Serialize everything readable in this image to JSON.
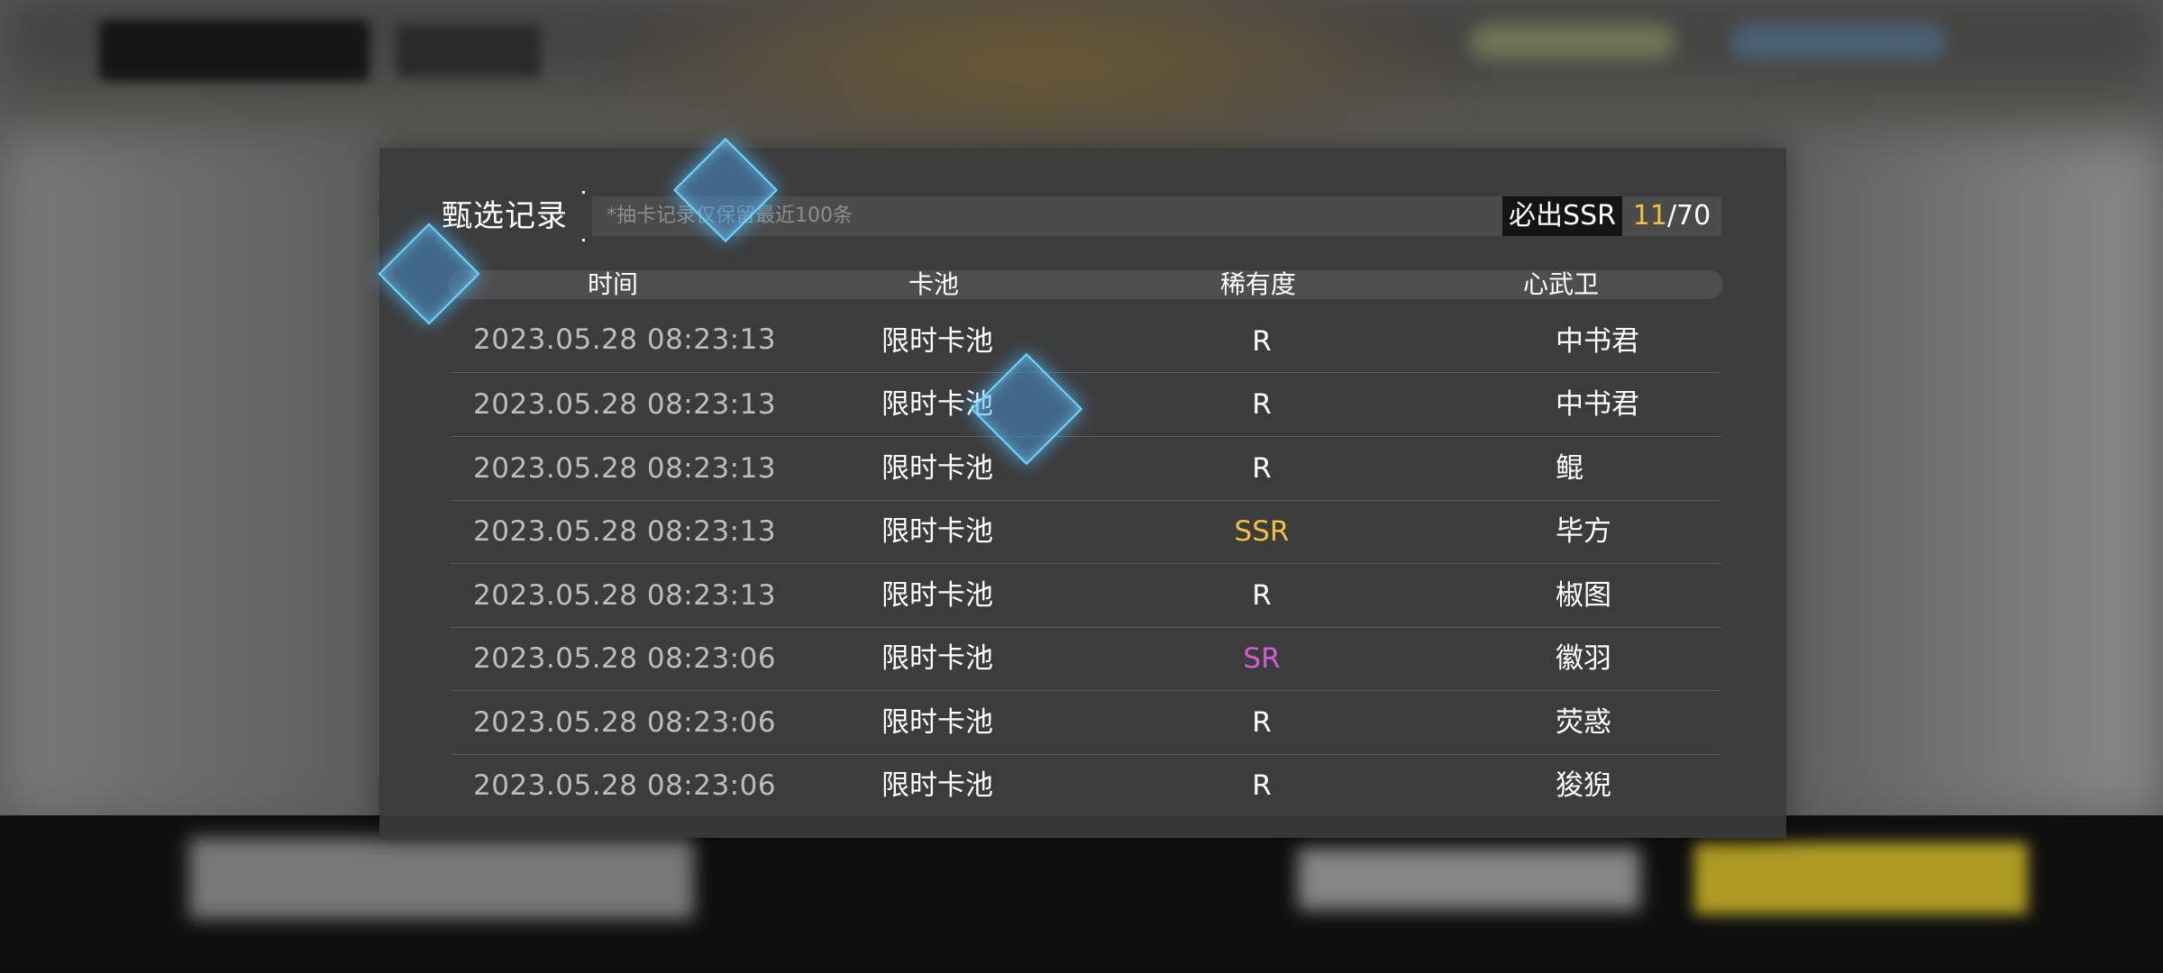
{
  "dialog": {
    "title": "甄选记录",
    "notice": "*抽卡记录仅保留最近100条",
    "guarantee": {
      "label": "必出SSR",
      "current": "11",
      "separator": "/",
      "total": "70"
    }
  },
  "table": {
    "headers": [
      "时间",
      "卡池",
      "稀有度",
      "心武卫"
    ],
    "rows": [
      {
        "time": "2023.05.28  08:23:13",
        "pool": "限时卡池",
        "rarity": "R",
        "name": "中书君"
      },
      {
        "time": "2023.05.28  08:23:13",
        "pool": "限时卡池",
        "rarity": "R",
        "name": "中书君"
      },
      {
        "time": "2023.05.28  08:23:13",
        "pool": "限时卡池",
        "rarity": "R",
        "name": "鲲"
      },
      {
        "time": "2023.05.28  08:23:13",
        "pool": "限时卡池",
        "rarity": "SSR",
        "name": "毕方"
      },
      {
        "time": "2023.05.28  08:23:13",
        "pool": "限时卡池",
        "rarity": "R",
        "name": "椒图"
      },
      {
        "time": "2023.05.28  08:23:06",
        "pool": "限时卡池",
        "rarity": "SR",
        "name": "徽羽"
      },
      {
        "time": "2023.05.28  08:23:06",
        "pool": "限时卡池",
        "rarity": "R",
        "name": "荧惑"
      },
      {
        "time": "2023.05.28  08:23:06",
        "pool": "限时卡池",
        "rarity": "R",
        "name": "狻猊"
      }
    ]
  },
  "colors": {
    "ssr": "#f0c040",
    "sr": "#d35bd8",
    "r": "#ffffff",
    "diamond": "#6fd6ff"
  },
  "icons": [
    "diamond-sparkle-icon"
  ]
}
